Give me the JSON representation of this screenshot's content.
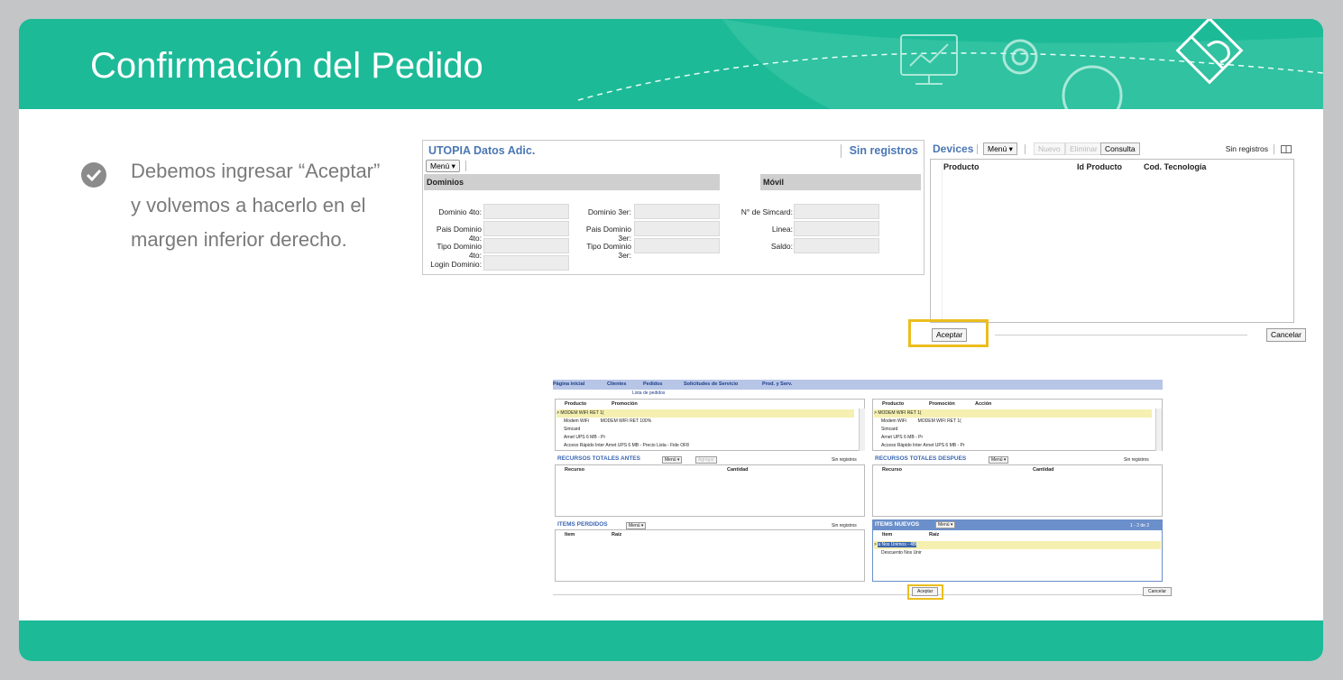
{
  "slide": {
    "title": "Confirmación del Pedido",
    "bullet_lines": [
      "Debemos ingresar “Aceptar”",
      "y volvemos a hacerlo en el",
      "margen inferior derecho."
    ]
  },
  "utopia": {
    "title": "UTOPIA Datos Adic.",
    "sin_registros": "Sin registros",
    "menu": "Menú ▾",
    "sections": [
      "Dominios",
      "Móvil"
    ],
    "col1_labels": [
      "Dominio 4to:",
      "Pais Dominio 4to:",
      "Tipo Dominio 4to:",
      "Login Dominio:"
    ],
    "col2_labels": [
      "Dominio 3er:",
      "Pais Dominio 3er:",
      "Tipo Dominio 3er:"
    ],
    "col3_labels": [
      "N° de Simcard:",
      "Linea:",
      "Saldo:"
    ]
  },
  "devices": {
    "title": "Devices",
    "buttons": {
      "menu": "Menú ▾",
      "nuevo": "Nuevo",
      "eliminar": "Eliminar",
      "consulta": "Consulta"
    },
    "sin_registros": "Sin registros",
    "columns": [
      "Producto",
      "Id Producto",
      "Cod. Tecnología"
    ],
    "aceptar": "Aceptar",
    "cancelar": "Cancelar"
  },
  "pedido": {
    "tabs": [
      "Página inicial",
      "Clientes",
      "Pedidos",
      "Solicitudes de Servicio",
      "Prod. y Serv."
    ],
    "sub": "Lista de pedidos",
    "left_cols": [
      "Producto",
      "Promoción"
    ],
    "right_cols": [
      "Producto",
      "Promoción",
      "Acción"
    ],
    "left_rows": [
      [
        "MODEM WIFI RET 1(",
        ""
      ],
      [
        "Modem WiFi",
        "MODEM WIFI RET 100%"
      ],
      [
        "Simcard",
        ""
      ],
      [
        "Arnet UPS 6 MB - Pr",
        ""
      ],
      [
        "Acceso Rápido Inter",
        "Arnet UPS 6 MB - Precio Lista - Fide OF8"
      ]
    ],
    "right_rows": [
      [
        "MODEM WIFI RET 1(",
        ""
      ],
      [
        "Modem WiFi",
        "MODEM WIFI RET 1("
      ],
      [
        "Simcard",
        ""
      ],
      [
        "Arnet UPS 6 MB - Pr",
        ""
      ],
      [
        "Acceso Rápido Inter",
        "Arnet UPS 6 MB - Pr"
      ]
    ],
    "rec_antes": {
      "title": "RECURSOS TOTALES ANTES",
      "menu": "Menú ▾",
      "agregar": "Agregar",
      "sin": "Sin registros",
      "cols": [
        "Recurso",
        "Cantidad"
      ]
    },
    "rec_despues": {
      "title": "RECURSOS TOTALES DESPUES",
      "menu": "Menú ▾",
      "sin": "Sin registros",
      "cols": [
        "Recurso",
        "Cantidad"
      ]
    },
    "items_perdidos": {
      "title": "ITEMS PERDIDOS",
      "menu": "Menú ▾",
      "sin": "Sin registros",
      "cols": [
        "Item",
        "Raíz"
      ]
    },
    "items_nuevos": {
      "title": "ITEMS NUEVOS",
      "menu": "Menú ▾",
      "count": "1 - 2 de 2",
      "cols": [
        "Item",
        "Raíz"
      ],
      "rows": [
        "a Nos Unimos - 4Bl",
        "Descuento Nos Unir"
      ]
    },
    "aceptar": "Aceptar",
    "cancelar": "Cancelar"
  },
  "colors": {
    "teal": "#1dba98",
    "highlight": "#ecbe1d",
    "link_blue": "#4a77b4"
  }
}
